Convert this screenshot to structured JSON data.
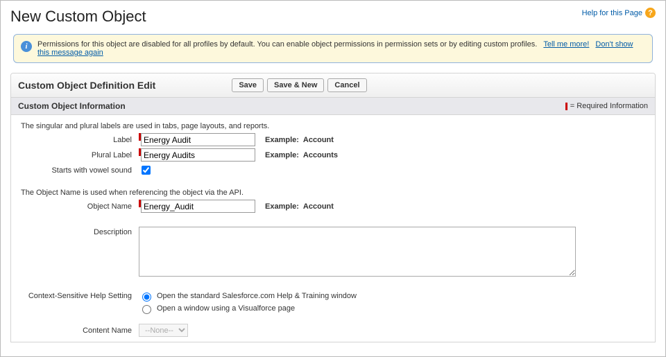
{
  "page_title": "New Custom Object",
  "help_link": "Help for this Page",
  "info_banner": {
    "text": "Permissions for this object are disabled for all profiles by default. You can enable object permissions in permission sets or by editing custom profiles.",
    "tell_me_more": "Tell me more!",
    "dont_show": "Don't show this message again"
  },
  "panel_title": "Custom Object Definition Edit",
  "buttons": {
    "save": "Save",
    "save_new": "Save & New",
    "cancel": "Cancel"
  },
  "section_title": "Custom Object Information",
  "required_legend": "= Required Information",
  "helper1": "The singular and plural labels are used in tabs, page layouts, and reports.",
  "helper2": "The Object Name is used when referencing the object via the API.",
  "labels": {
    "label": "Label",
    "plural_label": "Plural Label",
    "vowel": "Starts with vowel sound",
    "object_name": "Object Name",
    "description": "Description",
    "help_setting": "Context-Sensitive Help Setting",
    "content_name": "Content Name"
  },
  "values": {
    "label": "Energy Audit",
    "plural_label": "Energy Audits",
    "vowel_checked": true,
    "object_name": "Energy_Audit",
    "description": "",
    "help_option": "standard",
    "content_name": "--None--"
  },
  "examples": {
    "prefix": "Example:",
    "label": "Account",
    "plural_label": "Accounts",
    "object_name": "Account"
  },
  "help_options": {
    "standard": "Open the standard Salesforce.com Help & Training window",
    "vf": "Open a window using a Visualforce page"
  }
}
